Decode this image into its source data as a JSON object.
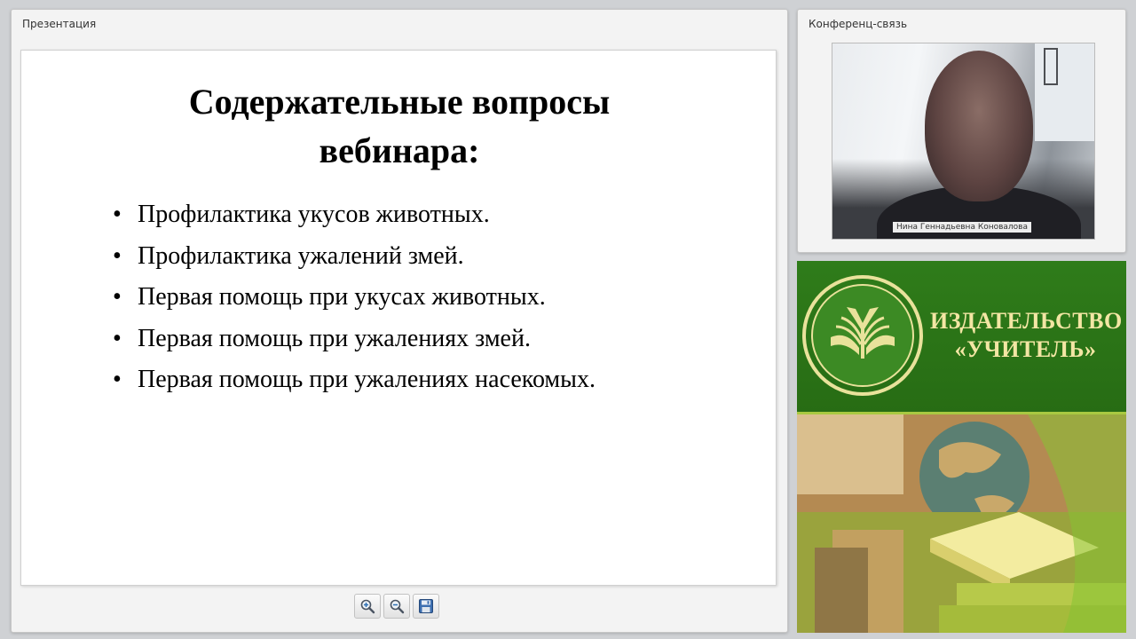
{
  "presentation": {
    "title": "Презентация",
    "slide": {
      "heading_lines": [
        "Содержательные вопросы",
        "вебинара:"
      ],
      "bullets": [
        "Профилактика укусов животных.",
        "Профилактика ужалений змей.",
        "Первая помощь при укусах животных.",
        "Первая помощь при ужалениях змей.",
        "Первая помощь при ужалениях насекомых."
      ]
    },
    "toolbar": {
      "buttons": [
        {
          "icon": "zoom-in-icon"
        },
        {
          "icon": "zoom-out-icon"
        },
        {
          "icon": "save-icon"
        }
      ]
    }
  },
  "conference": {
    "title": "Конференц-связь",
    "speaker_name": "Нина Геннадьевна Коновалова"
  },
  "publisher": {
    "name_lines": [
      "ИЗДАТЕЛЬСТВО",
      "«УЧИТЕЛЬ»"
    ],
    "colors": {
      "green": "#2f7c1a",
      "gold": "#f3e6a4",
      "accent": "#a9c941"
    }
  }
}
